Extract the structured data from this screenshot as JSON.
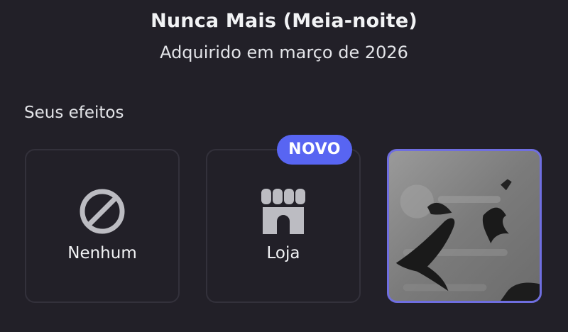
{
  "header": {
    "title": "Nunca Mais (Meia-noite)",
    "subtitle": "Adquirido em março de 2026"
  },
  "effects": {
    "section_label": "Seus efeitos",
    "options": [
      {
        "label": "Nenhum",
        "icon": "prohibited-icon"
      },
      {
        "label": "Loja",
        "icon": "storefront-icon",
        "badge": "NOVO"
      },
      {
        "label": "",
        "icon": "crow-effect-preview",
        "selected": true
      }
    ]
  },
  "colors": {
    "background": "#222028",
    "badge": "#5865f2",
    "selected_border": "#6f6ee0"
  }
}
